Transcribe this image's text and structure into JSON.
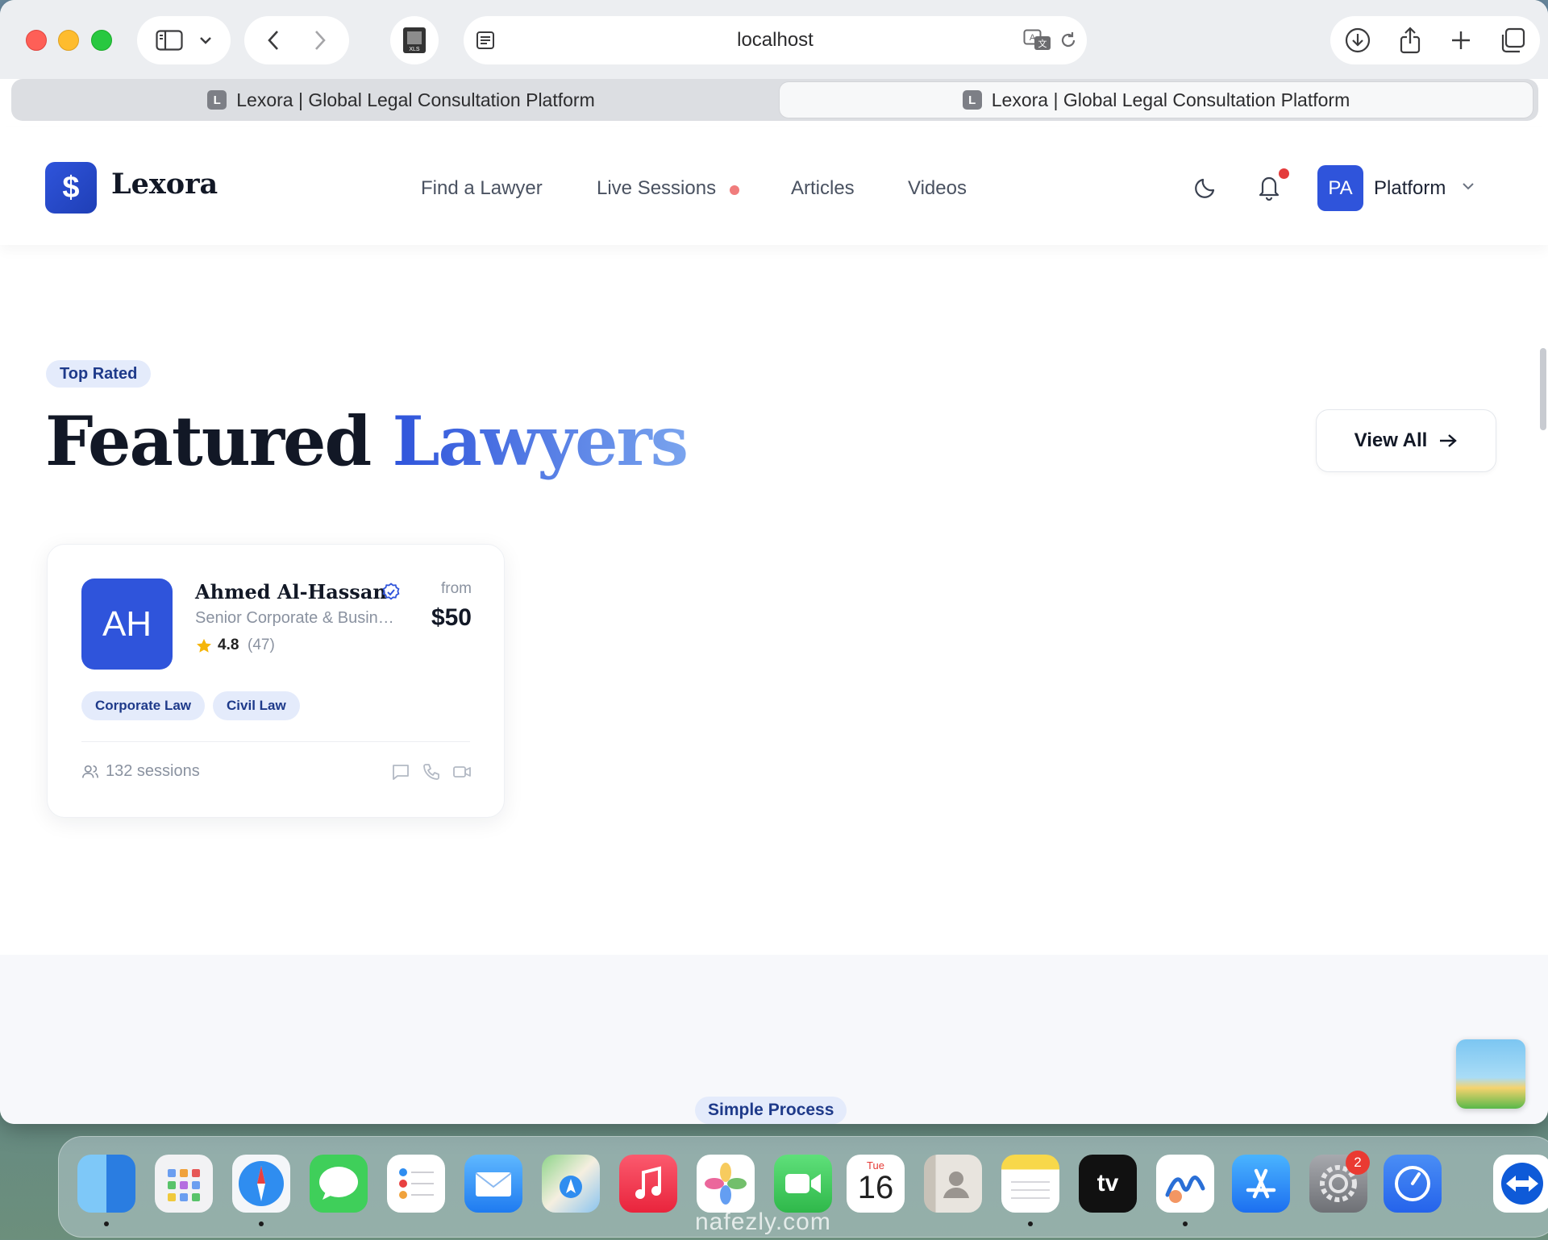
{
  "browser": {
    "url": "localhost",
    "tabs": [
      {
        "label": "Lexora | Global Legal Consultation Platform",
        "favicon": "L",
        "active": false
      },
      {
        "label": "Lexora | Global Legal Consultation Platform",
        "favicon": "L",
        "active": true
      }
    ],
    "icons": [
      "sidebar-icon",
      "chevron-down-icon",
      "back-icon",
      "forward-icon",
      "xls-file-icon",
      "reader-icon",
      "translate-icon",
      "reload-icon",
      "download-icon",
      "share-icon",
      "new-tab-icon",
      "tab-overview-icon"
    ]
  },
  "site": {
    "logo_symbol": "$",
    "brand": "Lexora",
    "nav": {
      "find_lawyer": "Find a Lawyer",
      "live_sessions": "Live Sessions",
      "articles": "Articles",
      "videos": "Videos"
    },
    "user": {
      "initials": "PA",
      "label": "Platform"
    },
    "accent_color": "#2f54db"
  },
  "featured": {
    "badge": "Top Rated",
    "title_main": "Featured",
    "title_accent": "Lawyers",
    "view_all": "View All",
    "lawyer": {
      "initials": "AH",
      "name": "Ahmed Al-Hassan",
      "title": "Senior Corporate & Business Lawyer",
      "rating": "4.8",
      "reviews": "(47)",
      "from_label": "from",
      "price": "$50",
      "tags": [
        "Corporate Law",
        "Civil Law"
      ],
      "sessions": "132 sessions"
    }
  },
  "process": {
    "badge": "Simple Process"
  },
  "dock": {
    "apps": [
      "finder-icon",
      "launchpad-icon",
      "safari-icon",
      "messages-icon",
      "reminders-icon",
      "mail-icon",
      "maps-icon",
      "music-icon",
      "photos-icon",
      "facetime-icon",
      "calendar-icon",
      "contacts-icon",
      "notes-icon",
      "apple-tv-icon",
      "freeform-icon",
      "app-store-icon",
      "system-settings-icon",
      "screen-time-icon",
      "teamviewer-icon"
    ],
    "calendar_day": "Tue",
    "calendar_date": "16",
    "tv_label": "tv",
    "settings_badge": "2"
  },
  "watermark": "nafezly.com"
}
